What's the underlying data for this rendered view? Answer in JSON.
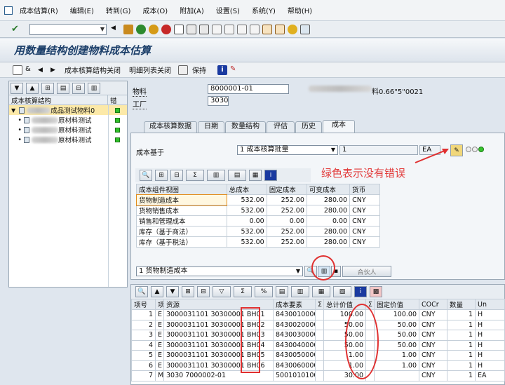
{
  "menu": [
    "成本估算(R)",
    "编辑(E)",
    "转到(G)",
    "成本(O)",
    "附加(A)",
    "设置(S)",
    "系统(Y)",
    "帮助(H)"
  ],
  "title": "用数量结构创建物料成本估算",
  "app_toolbar": {
    "close_structure": "成本核算结构关闭",
    "close_detail": "明细列表关闭",
    "keep": "保持"
  },
  "tree": {
    "col_structure": "成本核算结构",
    "col_error": "错",
    "root_label": "成品测试物料0",
    "children": [
      "原材料测试",
      "原材料测试",
      "原材料测试"
    ]
  },
  "header": {
    "material_label": "物料",
    "material_value": "8000001-01",
    "material_desc_suffix": "料0.66\"5\"0021",
    "plant_label": "工厂",
    "plant_value": "3030"
  },
  "tabs": [
    "成本核算数据",
    "日期",
    "数量结构",
    "评估",
    "历史",
    "成本"
  ],
  "cost_base": {
    "label": "成本基于",
    "value": "1 成本核算批量",
    "qty": "1",
    "unit": "EA"
  },
  "annotation_green": "绿色表示没有错误",
  "comp_grid": {
    "headers": [
      "成本组件视图",
      "总成本",
      "固定成本",
      "可变成本",
      "货币"
    ],
    "rows": [
      [
        "货物制造成本",
        "532.00",
        "252.00",
        "280.00",
        "CNY"
      ],
      [
        "货物销售成本",
        "532.00",
        "252.00",
        "280.00",
        "CNY"
      ],
      [
        "销售和管理成本",
        "0.00",
        "0.00",
        "0.00",
        "CNY"
      ],
      [
        "库存（基于商法）",
        "532.00",
        "252.00",
        "280.00",
        "CNY"
      ],
      [
        "库存（基于税法）",
        "532.00",
        "252.00",
        "280.00",
        "CNY"
      ]
    ]
  },
  "view_select": {
    "value": "1 货物制造成本",
    "partner_label": "合伙人"
  },
  "items_grid": {
    "headers": [
      "项号",
      "项",
      "资源",
      "成本要素",
      "Σ",
      "总计价值",
      "Σ",
      "固定价值",
      "COCr",
      "数量",
      "Un"
    ],
    "rows": [
      [
        "1",
        "E",
        "3000031101 30300001 BH01",
        "8430010000",
        "100.00",
        "100.00",
        "CNY",
        "1",
        "H"
      ],
      [
        "2",
        "E",
        "3000031101 30300001 BH02",
        "8430020000",
        "50.00",
        "50.00",
        "CNY",
        "1",
        "H"
      ],
      [
        "3",
        "E",
        "3000031101 30300001 BH03",
        "8430030000",
        "50.00",
        "50.00",
        "CNY",
        "1",
        "H"
      ],
      [
        "4",
        "E",
        "3000031101 30300001 BH04",
        "8430040000",
        "50.00",
        "50.00",
        "CNY",
        "1",
        "H"
      ],
      [
        "5",
        "E",
        "3000031101 30300001 BH05",
        "8430050000",
        "1.00",
        "1.00",
        "CNY",
        "1",
        "H"
      ],
      [
        "6",
        "E",
        "3000031101 30300001 BH06",
        "8430060000",
        "1.00",
        "1.00",
        "CNY",
        "1",
        "H"
      ],
      [
        "7",
        "M",
        "3030 7000002-01",
        "5001010100",
        "30.00",
        "",
        "CNY",
        "1",
        "EA"
      ]
    ]
  }
}
